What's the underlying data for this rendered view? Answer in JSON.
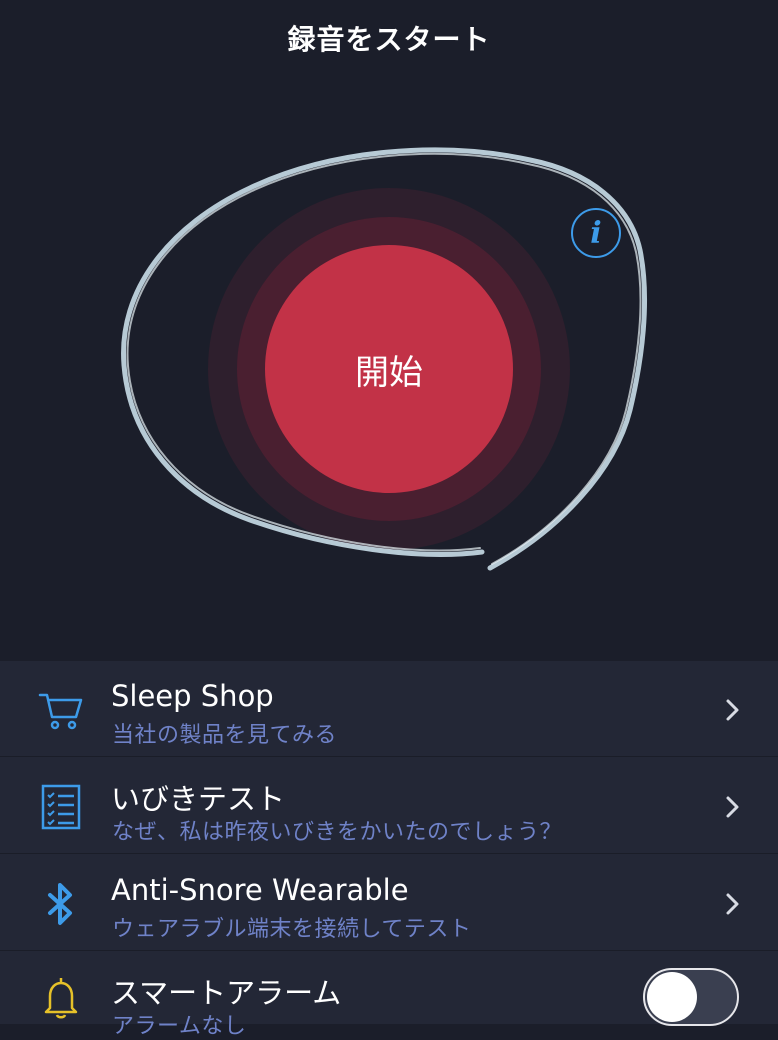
{
  "header": {
    "title": "録音をスタート"
  },
  "record": {
    "start_label": "開始",
    "info_icon": "info-icon"
  },
  "colors": {
    "background": "#1b1e2a",
    "record_red": "#c23247",
    "accent_blue": "#3d9be9",
    "subtitle_blue": "#6f82c8",
    "bell_yellow": "#e6c129"
  },
  "menu": {
    "items": [
      {
        "title": "Sleep Shop",
        "subtitle": "当社の製品を見てみる",
        "icon": "cart-icon"
      },
      {
        "title": "いびきテスト",
        "subtitle": "なぜ、私は昨夜いびきをかいたのでしょう？",
        "icon": "checklist-icon"
      },
      {
        "title": "Anti-Snore Wearable",
        "subtitle": "ウェアラブル端末を接続してテスト",
        "icon": "bluetooth-icon"
      },
      {
        "title": "スマートアラーム",
        "subtitle": "アラームなし",
        "icon": "bell-icon",
        "toggle_on": false
      }
    ]
  }
}
